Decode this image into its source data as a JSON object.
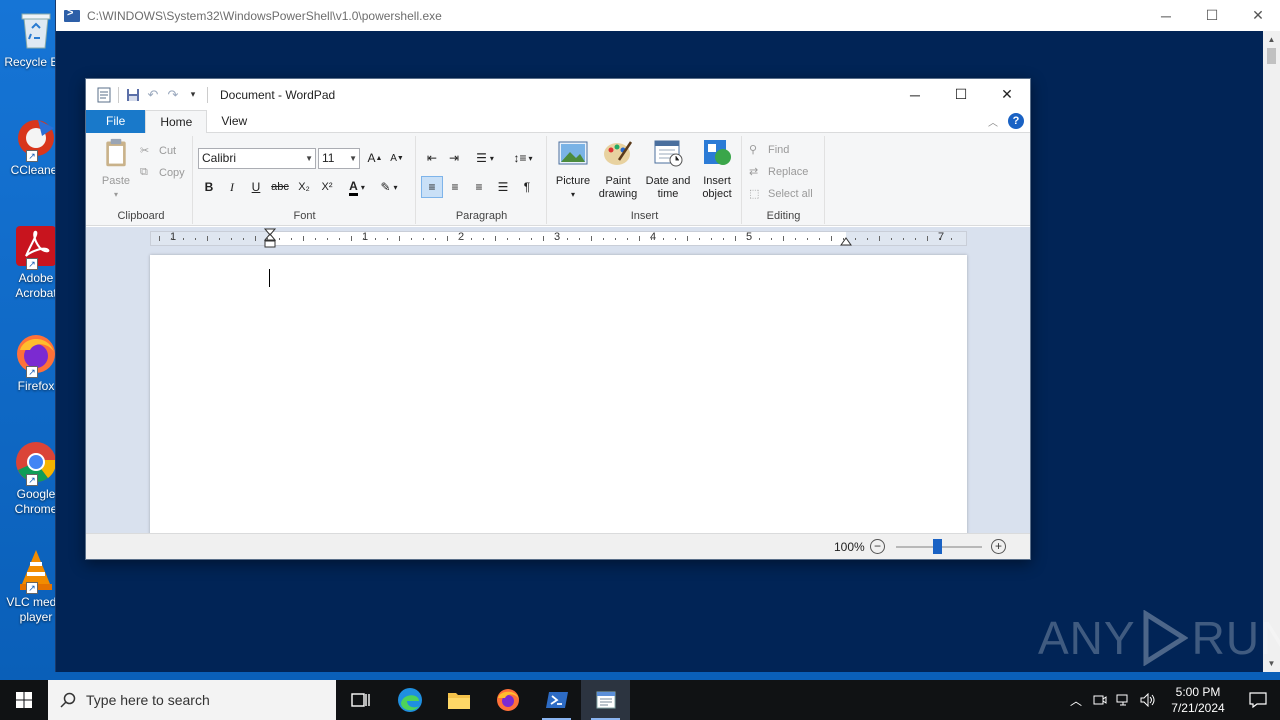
{
  "desktop": {
    "icons": [
      {
        "label": "Recycle Bin",
        "name": "recycle-bin"
      },
      {
        "label": "CCleaner",
        "name": "ccleaner"
      },
      {
        "label": "Adobe Acrobat",
        "name": "adobe-acrobat"
      },
      {
        "label": "Firefox",
        "name": "firefox"
      },
      {
        "label": "Google Chrome",
        "name": "google-chrome"
      },
      {
        "label": "VLC media player",
        "name": "vlc"
      }
    ]
  },
  "powershell": {
    "title": "C:\\WINDOWS\\System32\\WindowsPowerShell\\v1.0\\powershell.exe"
  },
  "watermark": {
    "left": "ANY",
    "right": "RUN"
  },
  "wordpad": {
    "title": "Document - WordPad",
    "tabs": {
      "file": "File",
      "home": "Home",
      "view": "View"
    },
    "clipboard": {
      "paste": "Paste",
      "cut": "Cut",
      "copy": "Copy",
      "label": "Clipboard"
    },
    "font": {
      "family": "Calibri",
      "size": "11",
      "label": "Font"
    },
    "paragraph": {
      "label": "Paragraph"
    },
    "insert": {
      "picture": "Picture",
      "paint_drawing_1": "Paint",
      "paint_drawing_2": "drawing",
      "date_time_1": "Date and",
      "date_time_2": "time",
      "insert_object_1": "Insert",
      "insert_object_2": "object",
      "label": "Insert"
    },
    "editing": {
      "find": "Find",
      "replace": "Replace",
      "select_all": "Select all",
      "label": "Editing"
    },
    "ruler_numbers": [
      "1",
      "1",
      "2",
      "3",
      "4",
      "5",
      "7"
    ],
    "zoom": {
      "label": "100%",
      "level_percent": 100
    }
  },
  "taskbar": {
    "search_placeholder": "Type here to search",
    "time": "5:00 PM",
    "date": "7/21/2024"
  }
}
